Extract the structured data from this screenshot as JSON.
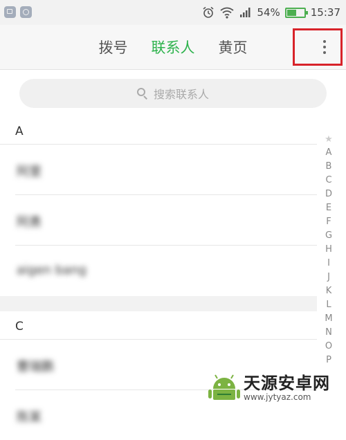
{
  "status_bar": {
    "battery_percent": "54%",
    "battery_level": 0.54,
    "time": "15:37",
    "icons": [
      "picture-notification-icon",
      "smile-notification-icon",
      "alarm-icon",
      "wifi-icon",
      "signal-icon",
      "battery-icon"
    ]
  },
  "tabs": [
    {
      "label": "拨号",
      "active": false
    },
    {
      "label": "联系人",
      "active": true
    },
    {
      "label": "黄页",
      "active": false
    }
  ],
  "menu": {
    "icon": "more-vert-icon"
  },
  "search": {
    "placeholder": "搜索联系人",
    "icon": "search-icon"
  },
  "sections": [
    {
      "header": "A",
      "contacts": [
        "阿里",
        "阿勇",
        "aigen bang"
      ]
    },
    {
      "header": "C",
      "contacts": [
        "曹瑞鹏",
        "陈某"
      ]
    }
  ],
  "alphabet_index": {
    "star": "★",
    "letters": [
      "A",
      "B",
      "C",
      "D",
      "E",
      "F",
      "G",
      "H",
      "I",
      "J",
      "K",
      "L",
      "M",
      "N",
      "O",
      "P"
    ]
  },
  "watermark": {
    "title": "天源安卓网",
    "url": "www.jytyaz.com"
  },
  "colors": {
    "accent": "#2eb34d",
    "highlight_box": "#d8232a",
    "battery": "#4caf50"
  }
}
